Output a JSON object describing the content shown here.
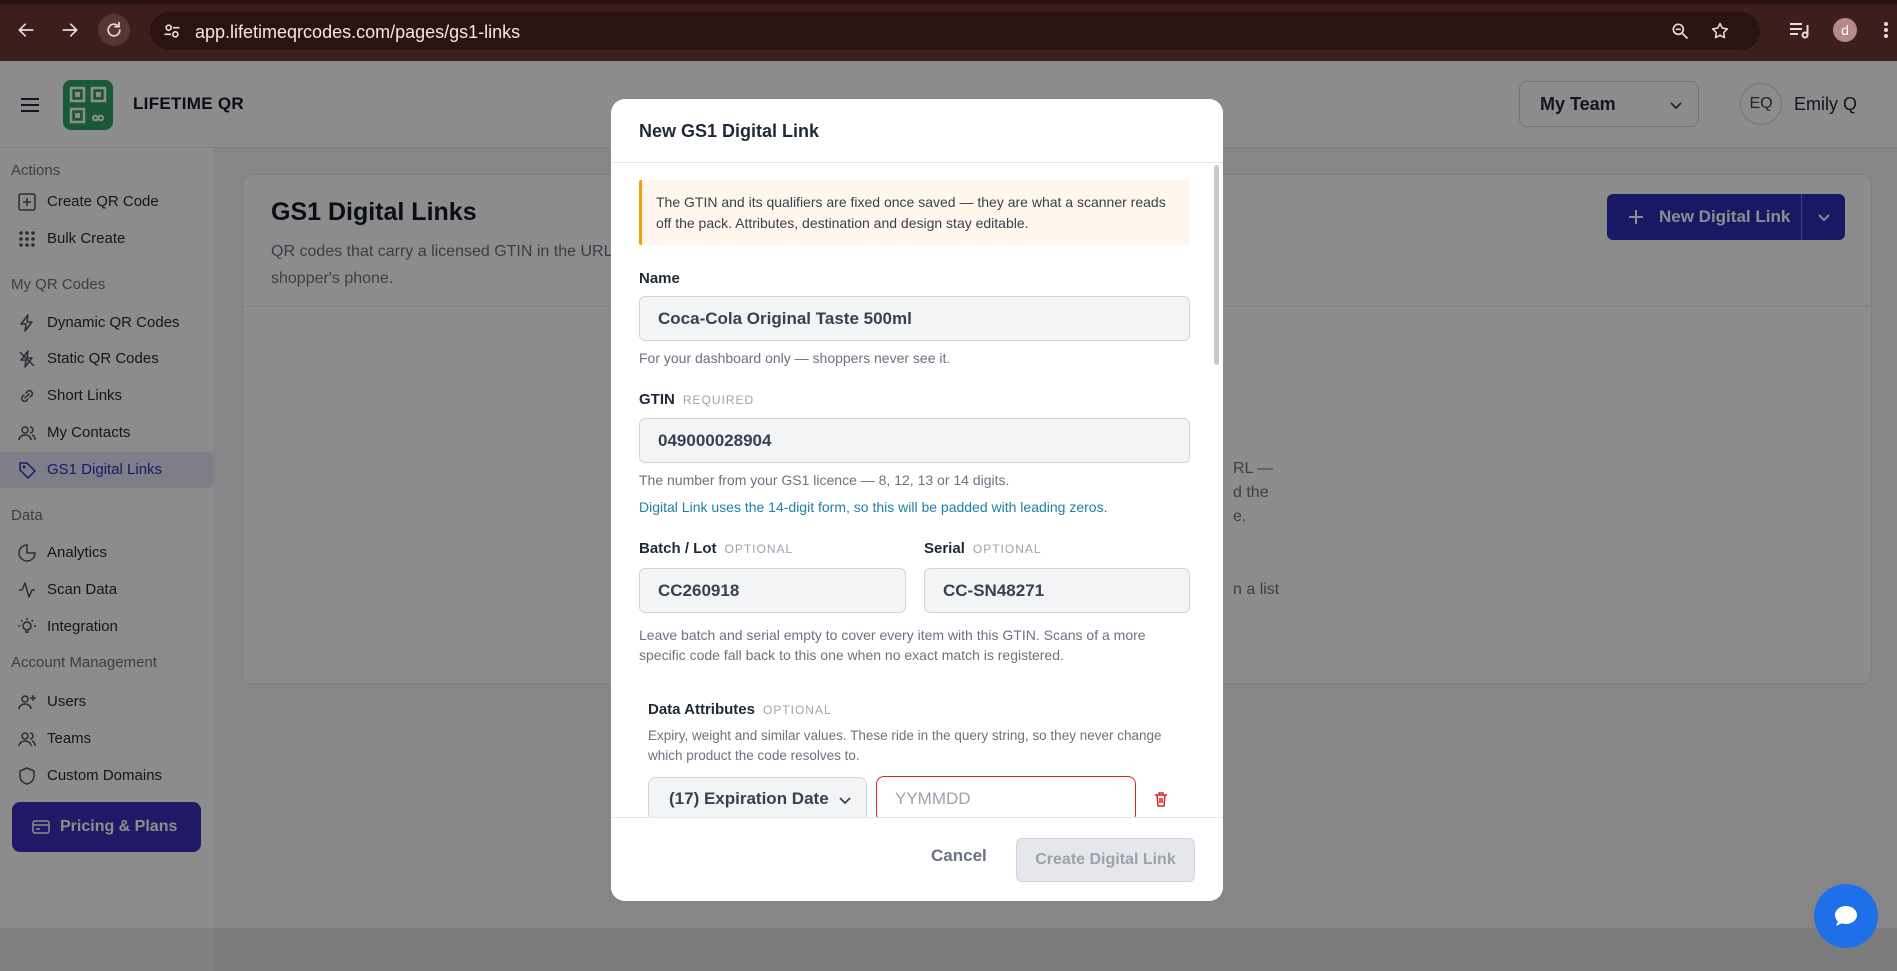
{
  "browser": {
    "url": "app.lifetimeqrcodes.com/pages/gs1-links",
    "profile_initial": "d"
  },
  "app": {
    "brand": "LIFETIME QR",
    "team_select": "My Team",
    "user_initials": "EQ",
    "user_name": "Emily Q"
  },
  "sidebar": {
    "sections": {
      "actions": "Actions",
      "my_qr_codes": "My QR Codes",
      "data": "Data",
      "account": "Account Management"
    },
    "items": {
      "create_qr": "Create QR Code",
      "bulk_create": "Bulk Create",
      "dynamic": "Dynamic QR Codes",
      "static": "Static QR Codes",
      "short_links": "Short Links",
      "contacts": "My Contacts",
      "gs1": "GS1 Digital Links",
      "analytics": "Analytics",
      "scan_data": "Scan Data",
      "integration": "Integration",
      "users": "Users",
      "teams": "Teams",
      "custom_domains": "Custom Domains"
    },
    "pricing": "Pricing & Plans"
  },
  "page": {
    "title": "GS1 Digital Links",
    "description": "QR codes that carry a licensed GTIN in the URL a shopper's phone.",
    "new_button": "New Digital Link",
    "bg_fragments": [
      "RL —",
      "d the",
      "e.",
      "n a list"
    ]
  },
  "modal": {
    "title": "New GS1 Digital Link",
    "notice": "The GTIN and its qualifiers are fixed once saved — they are what a scanner reads off the pack. Attributes, destination and design stay editable.",
    "name": {
      "label": "Name",
      "value": "Coca-Cola Original Taste 500ml",
      "help": "For your dashboard only — shoppers never see it."
    },
    "gtin": {
      "label": "GTIN",
      "tag": "REQUIRED",
      "value": "049000028904",
      "help": "The number from your GS1 licence — 8, 12, 13 or 14 digits.",
      "help2": "Digital Link uses the 14-digit form, so this will be padded with leading zeros."
    },
    "batch": {
      "label": "Batch / Lot",
      "tag": "OPTIONAL",
      "value": "CC260918"
    },
    "serial": {
      "label": "Serial",
      "tag": "OPTIONAL",
      "value": "CC-SN48271"
    },
    "qualifiers_help": "Leave batch and serial empty to cover every item with this GTIN. Scans of a more specific code fall back to this one when no exact match is registered.",
    "attributes": {
      "label": "Data Attributes",
      "tag": "OPTIONAL",
      "help": "Expiry, weight and similar values. These ride in the query string, so they never change which product the code resolves to.",
      "row": {
        "selected": "(17) Expiration Date",
        "placeholder": "YYMMDD"
      }
    },
    "footer": {
      "cancel": "Cancel",
      "create": "Create Digital Link"
    }
  },
  "colors": {
    "brand_primary": "#2b2fb8",
    "logo_green": "#2fa36b",
    "error_red": "#dc2626",
    "notice_bg": "#fff7ec",
    "notice_border": "#f59e0b",
    "chat_blue": "#1e6fe8"
  }
}
